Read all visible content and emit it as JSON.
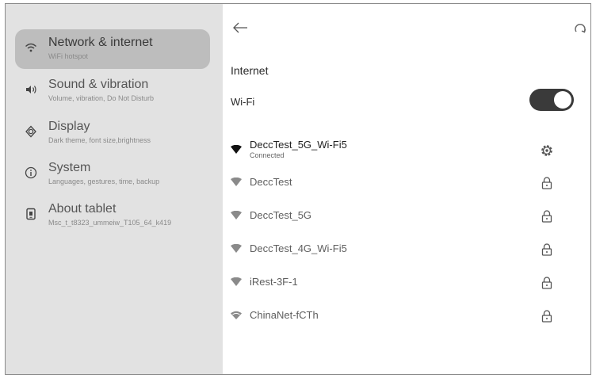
{
  "sidebar": {
    "items": [
      {
        "title": "Network & internet",
        "subtitle": "WiFi hotspot",
        "icon": "wifi-icon",
        "active": true
      },
      {
        "title": "Sound & vibration",
        "subtitle": "Volume, vibration, Do Not Disturb",
        "icon": "volume-icon"
      },
      {
        "title": "Display",
        "subtitle": "Dark theme, font size,brightness",
        "icon": "display-icon"
      },
      {
        "title": "System",
        "subtitle": "Languages, gestures, time, backup",
        "icon": "info-icon"
      },
      {
        "title": "About tablet",
        "subtitle": "Msc_t_t8323_ummeiw_T105_64_k419",
        "icon": "tablet-icon"
      }
    ]
  },
  "main": {
    "section_title": "Internet",
    "wifi_label": "Wi-Fi",
    "wifi_enabled": true,
    "networks": [
      {
        "name": "DeccTest_5G_Wi-Fi5",
        "status": "Connected",
        "action_icon": "gear-icon",
        "connected": true
      },
      {
        "name": "DeccTest",
        "action_icon": "lock-icon"
      },
      {
        "name": "DeccTest_5G",
        "action_icon": "lock-icon"
      },
      {
        "name": "DeccTest_4G_Wi-Fi5",
        "action_icon": "lock-icon"
      },
      {
        "name": "iRest-3F-1",
        "action_icon": "lock-icon"
      },
      {
        "name": "ChinaNet-fCTh",
        "action_icon": "lock-icon"
      }
    ]
  },
  "colors": {
    "sidebar_bg": "#e2e2e2",
    "active_item_bg": "#bdbdbd",
    "toggle_on": "#3a3a3a"
  }
}
